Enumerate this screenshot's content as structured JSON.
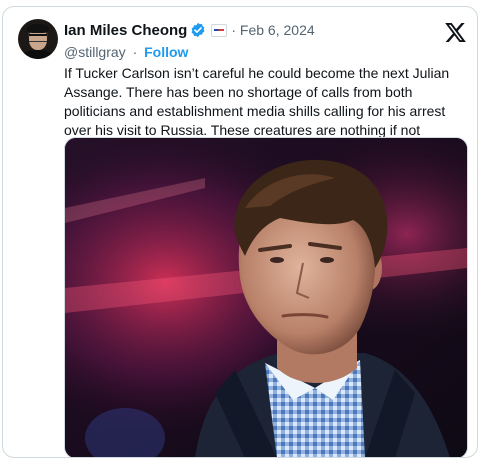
{
  "tweet": {
    "author_name": "Ian Miles Cheong",
    "verified": true,
    "date": "Feb 6, 2024",
    "handle": "@stillgray",
    "separator": "·",
    "follow_label": "Follow",
    "text": "If Tucker Carlson isn’t careful he could become the next Julian Assange. There has been no shortage of calls from both politicians and establishment media shills calling for his arrest over his visit to Russia. These creatures are nothing if not vindictive."
  },
  "icons": {
    "verified": "verified-badge-icon",
    "flag": "flag-icon",
    "platform": "x-logo-icon"
  },
  "colors": {
    "accent": "#1d9bf0",
    "text": "#0f1419",
    "muted": "#536471",
    "border": "#cfd9de"
  }
}
